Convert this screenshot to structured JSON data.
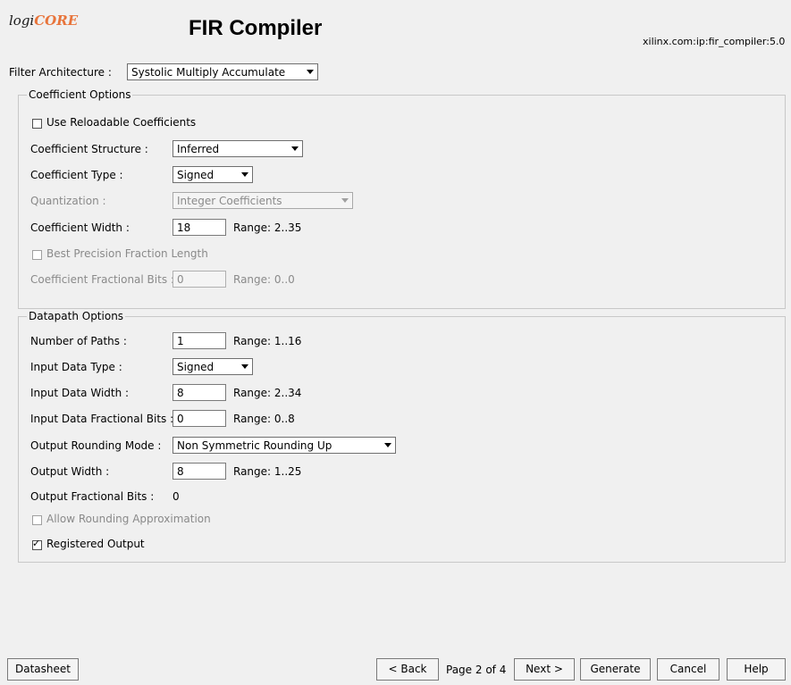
{
  "header": {
    "logo_logi": "logi",
    "logo_core": "CORE",
    "title": "FIR Compiler",
    "vlnv": "xilinx.com:ip:fir_compiler:5.0"
  },
  "filter_architecture": {
    "label": "Filter Architecture :",
    "value": "Systolic Multiply Accumulate"
  },
  "coefficient_options": {
    "legend": "Coefficient Options",
    "reloadable_label": "Use Reloadable Coefficients",
    "reloadable_checked": false,
    "structure_label": "Coefficient Structure :",
    "structure_value": "Inferred",
    "type_label": "Coefficient Type :",
    "type_value": "Signed",
    "quantization_label": "Quantization :",
    "quantization_value": "Integer Coefficients",
    "width_label": "Coefficient Width :",
    "width_value": "18",
    "width_range": "Range: 2..35",
    "best_precision_label": "Best Precision Fraction Length",
    "best_precision_checked": false,
    "frac_bits_label": "Coefficient Fractional Bits :",
    "frac_bits_value": "0",
    "frac_bits_range": "Range: 0..0"
  },
  "datapath_options": {
    "legend": "Datapath Options",
    "paths_label": "Number of Paths :",
    "paths_value": "1",
    "paths_range": "Range: 1..16",
    "input_type_label": "Input Data Type :",
    "input_type_value": "Signed",
    "input_width_label": "Input Data Width :",
    "input_width_value": "8",
    "input_width_range": "Range: 2..34",
    "input_frac_label": "Input Data Fractional Bits :",
    "input_frac_value": "0",
    "input_frac_range": "Range: 0..8",
    "rounding_label": "Output Rounding Mode :",
    "rounding_value": "Non Symmetric Rounding Up",
    "output_width_label": "Output Width :",
    "output_width_value": "8",
    "output_width_range": "Range: 1..25",
    "output_frac_label": "Output Fractional Bits :",
    "output_frac_value": "0",
    "allow_rounding_label": "Allow Rounding Approximation",
    "allow_rounding_checked": false,
    "registered_output_label": "Registered Output",
    "registered_output_checked": true
  },
  "footer": {
    "datasheet": "Datasheet",
    "back": "< Back",
    "page": "Page 2 of 4",
    "next": "Next >",
    "generate": "Generate",
    "cancel": "Cancel",
    "help": "Help"
  },
  "icons": {
    "dropdown": "chevron-down-icon",
    "check": "checkmark-icon"
  }
}
